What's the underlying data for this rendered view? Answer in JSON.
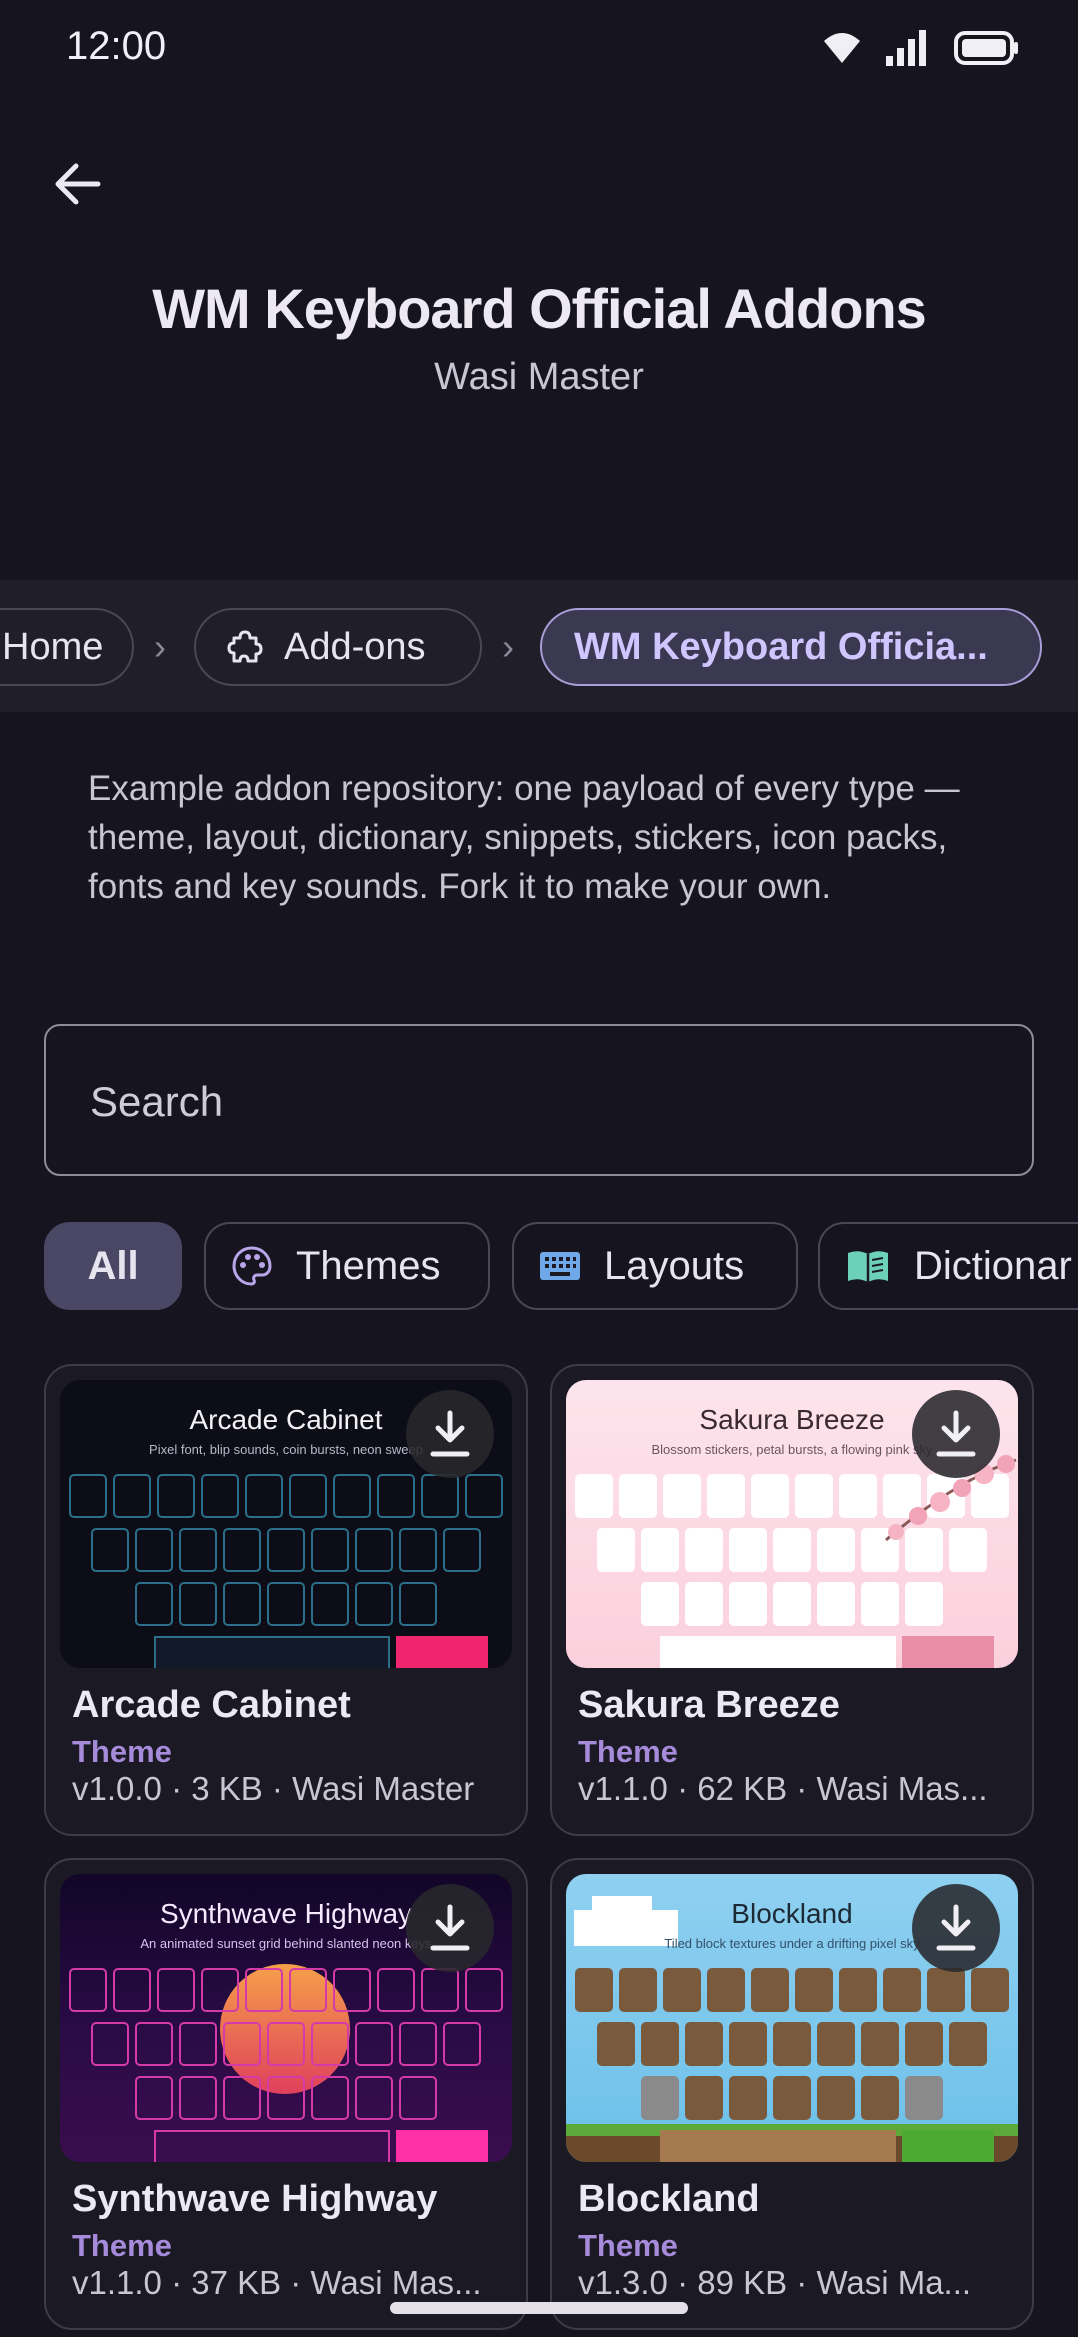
{
  "status_bar": {
    "time": "12:00"
  },
  "header": {
    "title": "WM Keyboard Official Addons",
    "subtitle": "Wasi Master"
  },
  "breadcrumb": {
    "home": "Home",
    "addons": "Add-ons",
    "current": "WM Keyboard Officia..."
  },
  "description": "Example addon repository: one payload of every type — theme, layout, dictionary, snippets, stickers, icon packs, fonts and key sounds. Fork it to make your own.",
  "search": {
    "placeholder": "Search",
    "value": ""
  },
  "filters": [
    "All",
    "Themes",
    "Layouts",
    "Dictionar"
  ],
  "cards": [
    {
      "name": "Arcade Cabinet",
      "type": "Theme",
      "meta": "v1.0.0 · 3 KB · Wasi Master",
      "preview_title": "Arcade Cabinet",
      "preview_tagline": "Pixel font, blip sounds, coin bursts, neon sweep"
    },
    {
      "name": "Sakura Breeze",
      "type": "Theme",
      "meta": "v1.1.0 · 62 KB · Wasi Mas...",
      "preview_title": "Sakura Breeze",
      "preview_tagline": "Blossom stickers, petal bursts, a flowing pink sky"
    },
    {
      "name": "Synthwave Highway",
      "type": "Theme",
      "meta": "v1.1.0 · 37 KB · Wasi Mas...",
      "preview_title": "Synthwave Highway",
      "preview_tagline": "An animated sunset grid behind slanted neon keys"
    },
    {
      "name": "Blockland",
      "type": "Theme",
      "meta": "v1.3.0 · 89 KB · Wasi Ma...",
      "preview_title": "Blockland",
      "preview_tagline": "Tiled block textures under a drifting pixel sky"
    }
  ],
  "colors": {
    "accent": "#a78bdb",
    "background": "#16151f",
    "chip_selected": "#4a4764"
  },
  "icons": {
    "back": "arrow-left-icon",
    "addons": "puzzle-icon",
    "themes": "palette-icon",
    "layouts": "keyboard-icon",
    "dictionary": "book-icon",
    "download": "download-icon"
  }
}
